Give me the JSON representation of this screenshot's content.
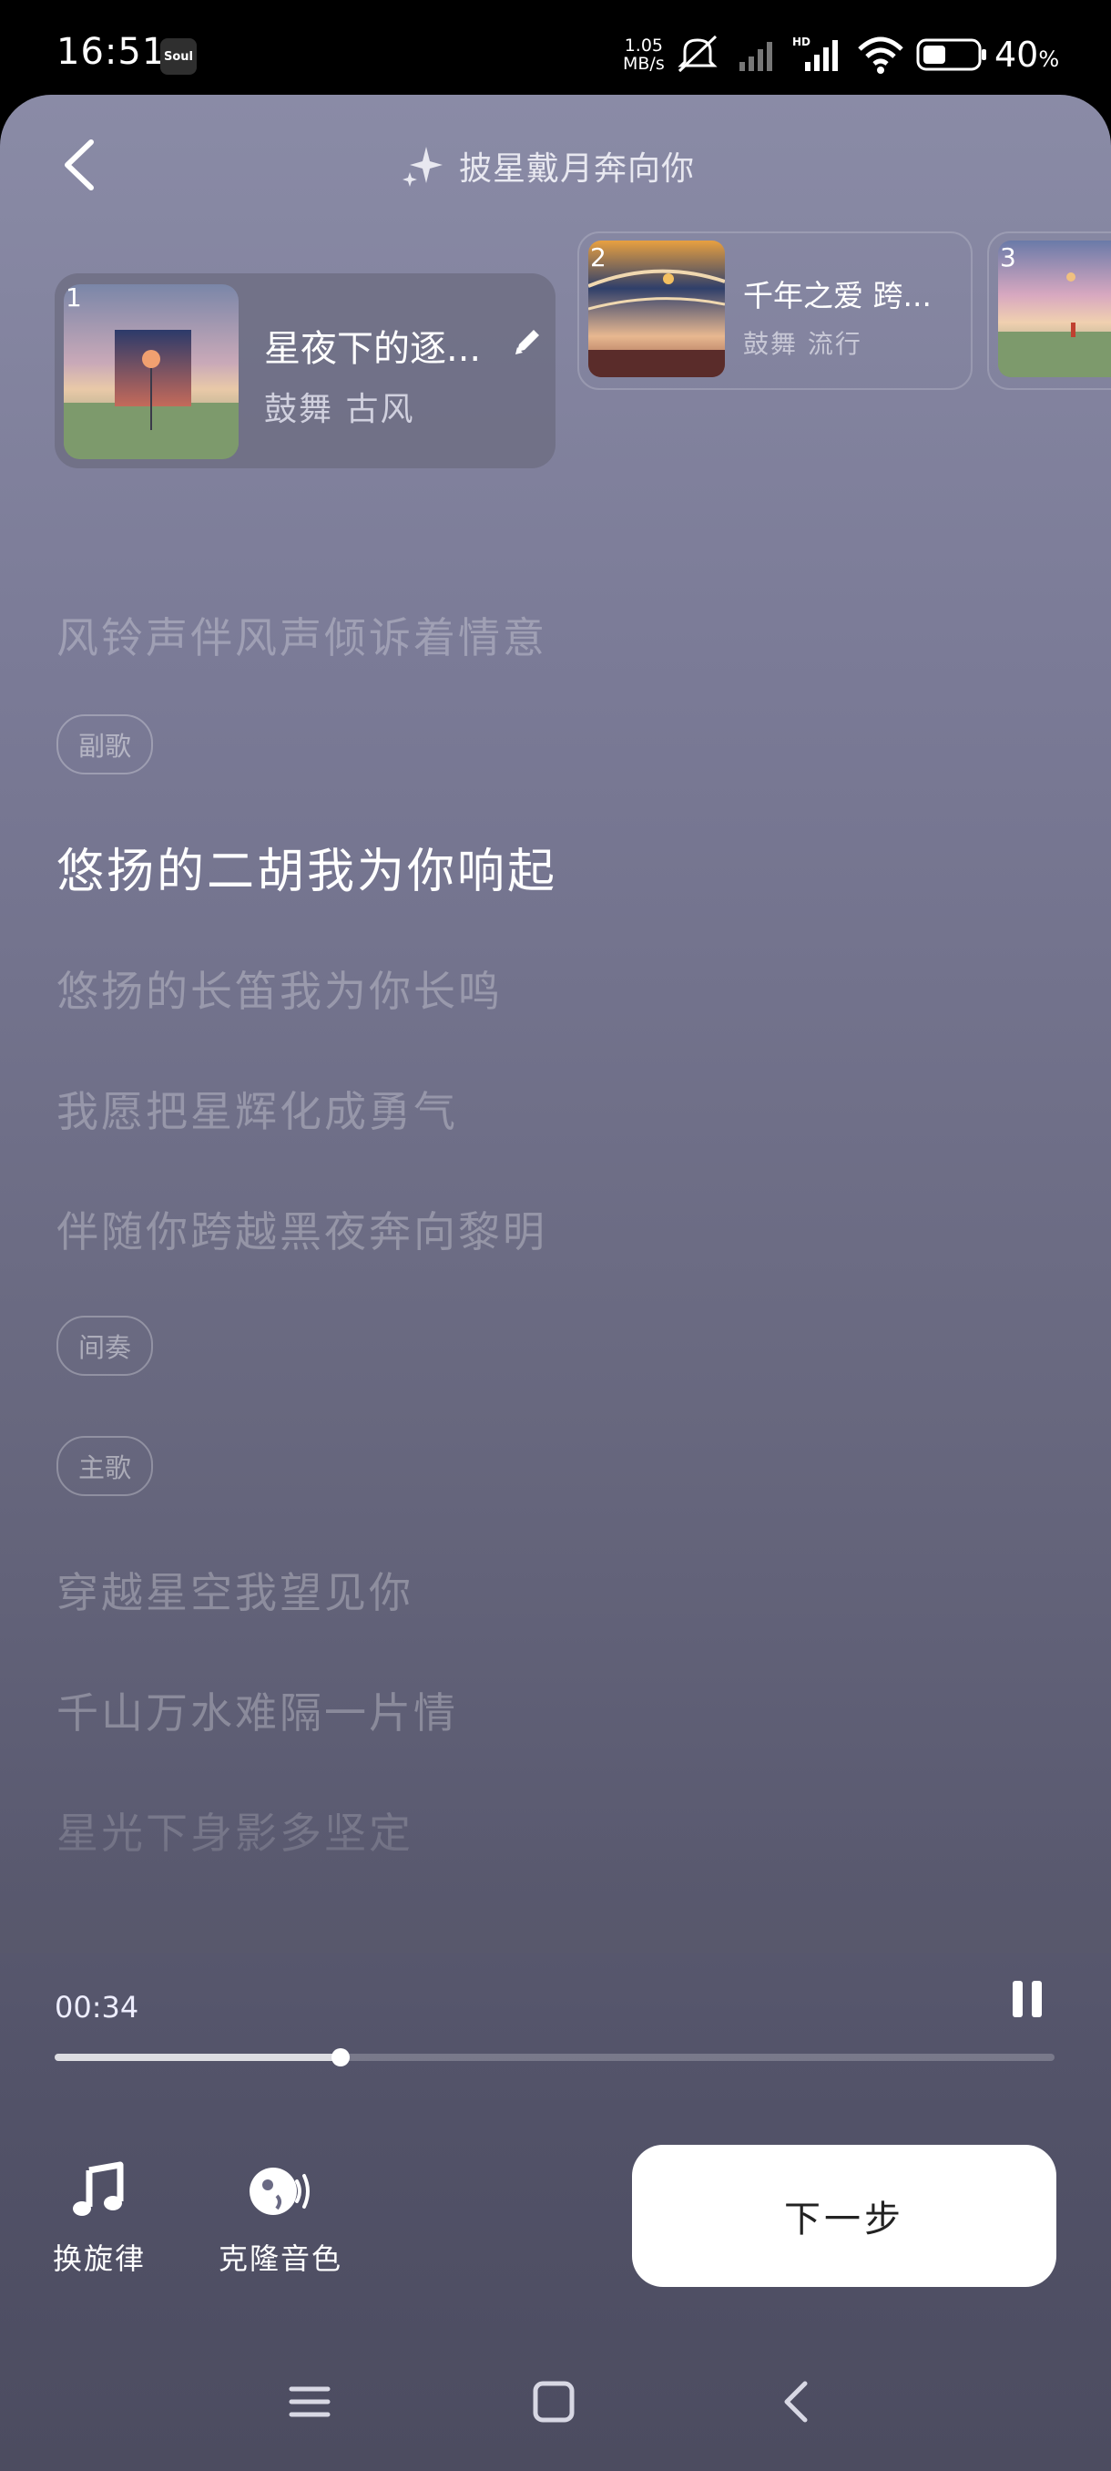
{
  "status_bar": {
    "time": "16:51",
    "app_badge": "Soul",
    "net_speed_value": "1.05",
    "net_speed_unit": "MB/s",
    "battery_percent": "40",
    "battery_unit": "%"
  },
  "header": {
    "title": "披星戴月奔向你"
  },
  "cards": [
    {
      "index": "1",
      "name": "星夜下的逐...",
      "tags": "鼓舞 古风"
    },
    {
      "index": "2",
      "name": "千年之爱 跨...",
      "tags": "鼓舞 流行"
    },
    {
      "index": "3"
    }
  ],
  "lyrics": {
    "line_pre": "风铃声伴风声倾诉着情意",
    "tag_chorus": "副歌",
    "line_active": "悠扬的二胡我为你响起",
    "line_2": "悠扬的长笛我为你长鸣",
    "line_3": "我愿把星辉化成勇气",
    "line_4": "伴随你跨越黑夜奔向黎明",
    "tag_interlude": "间奏",
    "tag_verse": "主歌",
    "line_5": "穿越星空我望见你",
    "line_6": "千山万水难隔一片情",
    "line_7": "星光下身影多坚定"
  },
  "player": {
    "current_time": "00:34",
    "progress": 0.286
  },
  "tools": {
    "melody_label": "换旋律",
    "clone_label": "克隆音色"
  },
  "next_button": "下一步",
  "colors": {
    "accent": "#ffffff",
    "bg_top": "#8a8ba6",
    "bg_bottom": "#4c4c60"
  }
}
